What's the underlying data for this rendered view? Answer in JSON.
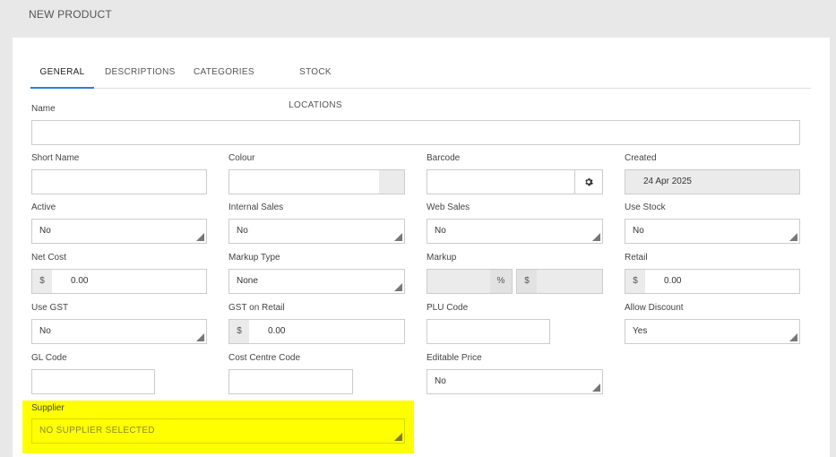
{
  "page": {
    "title": "NEW PRODUCT"
  },
  "tabs": [
    {
      "label": "GENERAL"
    },
    {
      "label": "DESCRIPTIONS"
    },
    {
      "label": "CATEGORIES"
    },
    {
      "label": "STOCK LOCATIONS"
    }
  ],
  "form": {
    "name": {
      "label": "Name",
      "value": ""
    },
    "short_name": {
      "label": "Short Name",
      "value": ""
    },
    "colour": {
      "label": "Colour",
      "value": ""
    },
    "barcode": {
      "label": "Barcode",
      "value": "",
      "icon": "gear-icon"
    },
    "created": {
      "label": "Created",
      "value": "24 Apr 2025"
    },
    "active": {
      "label": "Active",
      "value": "No"
    },
    "internal_sales": {
      "label": "Internal Sales",
      "value": "No"
    },
    "web_sales": {
      "label": "Web Sales",
      "value": "No"
    },
    "use_stock": {
      "label": "Use Stock",
      "value": "No"
    },
    "net_cost": {
      "label": "Net Cost",
      "prefix": "$",
      "value": "0.00"
    },
    "markup_type": {
      "label": "Markup Type",
      "value": "None"
    },
    "markup": {
      "label": "Markup",
      "value": "",
      "percent": "%",
      "dollar": "$",
      "dollar_value": ""
    },
    "retail": {
      "label": "Retail",
      "prefix": "$",
      "value": "0.00"
    },
    "use_gst": {
      "label": "Use GST",
      "value": "No"
    },
    "gst_on_retail": {
      "label": "GST on Retail",
      "prefix": "$",
      "value": "0.00"
    },
    "plu_code": {
      "label": "PLU Code",
      "value": ""
    },
    "allow_discount": {
      "label": "Allow Discount",
      "value": "Yes"
    },
    "gl_code": {
      "label": "GL Code",
      "value": ""
    },
    "cost_centre_code": {
      "label": "Cost Centre Code",
      "value": ""
    },
    "editable_price": {
      "label": "Editable Price",
      "value": "No"
    },
    "supplier": {
      "label": "Supplier",
      "value": "NO SUPPLIER SELECTED",
      "highlight_color": "#ffff00"
    }
  },
  "colors": {
    "tab_active_underline": "#2a7fd6",
    "readonly_bg": "#ebebeb",
    "highlight": "#ffff00"
  }
}
